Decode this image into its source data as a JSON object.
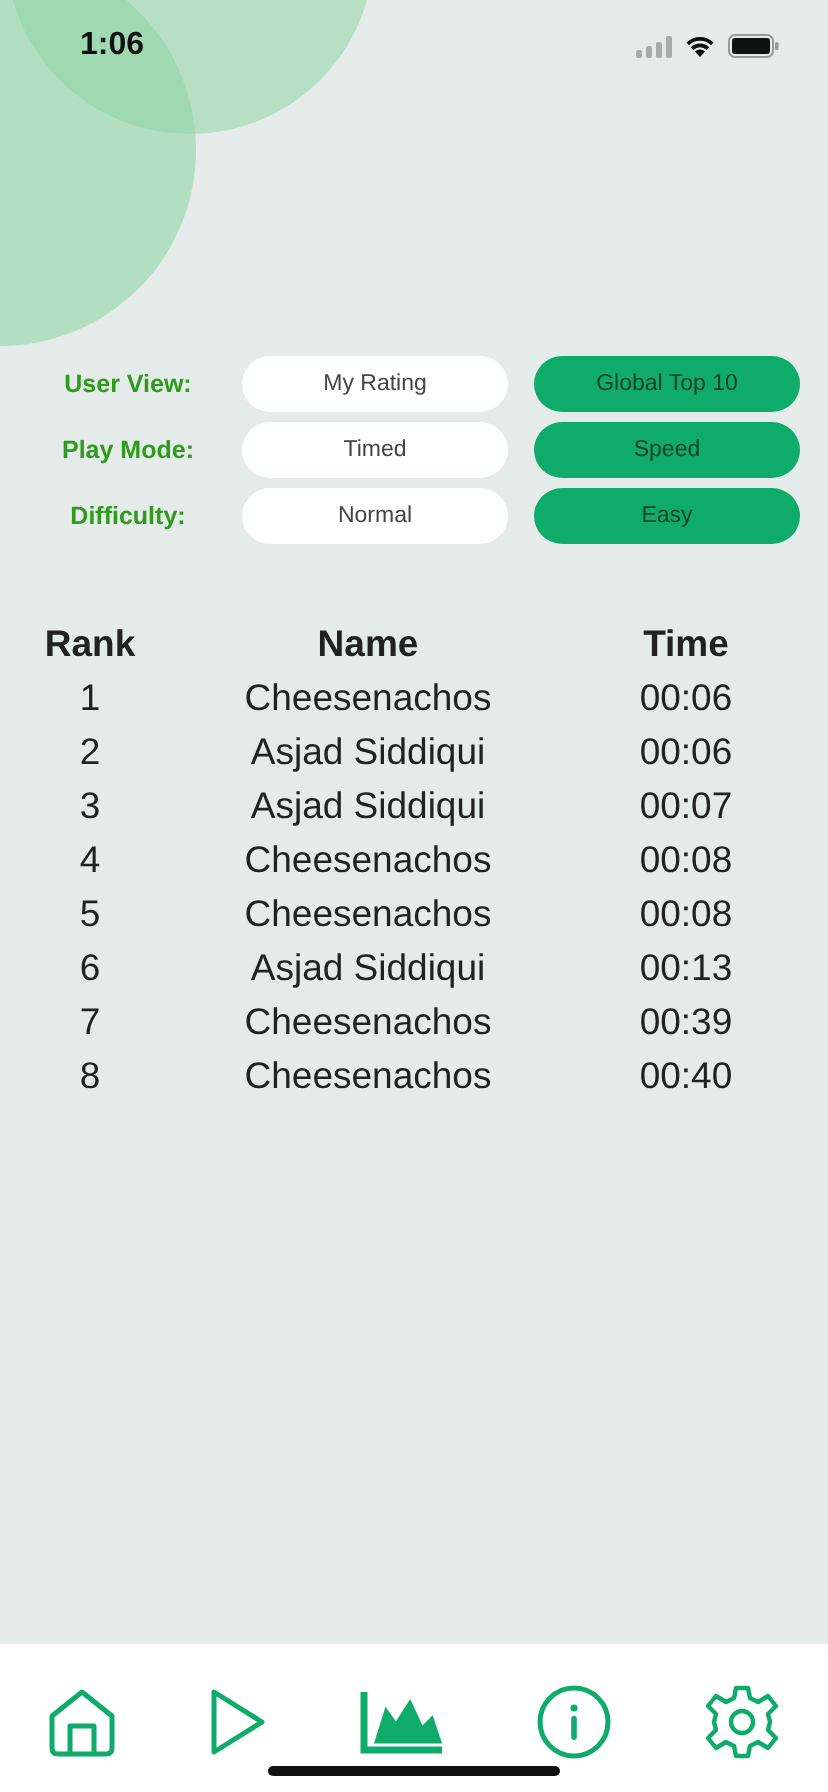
{
  "status_bar": {
    "time": "1:06"
  },
  "filters": [
    {
      "label": "User View:",
      "options": [
        {
          "label": "My Rating",
          "selected": false
        },
        {
          "label": "Global Top 10",
          "selected": true
        }
      ]
    },
    {
      "label": "Play Mode:",
      "options": [
        {
          "label": "Timed",
          "selected": false
        },
        {
          "label": "Speed",
          "selected": true
        }
      ]
    },
    {
      "label": "Difficulty:",
      "options": [
        {
          "label": "Normal",
          "selected": false
        },
        {
          "label": "Easy",
          "selected": true
        }
      ]
    }
  ],
  "table": {
    "columns": [
      "Rank",
      "Name",
      "Time"
    ],
    "rows": [
      [
        "1",
        "Cheesenachos",
        "00:06"
      ],
      [
        "2",
        "Asjad Siddiqui",
        "00:06"
      ],
      [
        "3",
        "Asjad Siddiqui",
        "00:07"
      ],
      [
        "4",
        "Cheesenachos",
        "00:08"
      ],
      [
        "5",
        "Cheesenachos",
        "00:08"
      ],
      [
        "6",
        "Asjad Siddiqui",
        "00:13"
      ],
      [
        "7",
        "Cheesenachos",
        "00:39"
      ],
      [
        "8",
        "Cheesenachos",
        "00:40"
      ]
    ]
  },
  "tab_bar": [
    {
      "kind": "home",
      "selected": false
    },
    {
      "kind": "play",
      "selected": false
    },
    {
      "kind": "stats",
      "selected": true
    },
    {
      "kind": "info",
      "selected": false
    },
    {
      "kind": "settings",
      "selected": false
    }
  ]
}
